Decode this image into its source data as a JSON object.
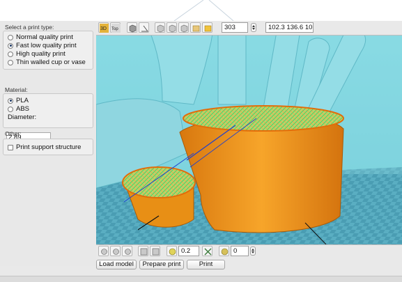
{
  "print_type": {
    "title": "Select a print type:",
    "options": [
      {
        "label": "Normal quality print",
        "selected": false
      },
      {
        "label": "Fast low quality print",
        "selected": true
      },
      {
        "label": "High quality print",
        "selected": false
      },
      {
        "label": "Thin walled cup or vase",
        "selected": false
      }
    ]
  },
  "material": {
    "title": "Material:",
    "options": [
      {
        "label": "PLA",
        "selected": true
      },
      {
        "label": "ABS",
        "selected": false
      }
    ],
    "diameter_label": "Diameter:",
    "diameter_value": "2.89"
  },
  "other": {
    "title": "Other:",
    "support_label": "Print support structure",
    "support_checked": false
  },
  "toolbar": {
    "icons": [
      "3d-view-icon",
      "top-view-icon",
      "cube-icon",
      "angle-icon",
      "layer-view-icon",
      "layer-view-icon",
      "layer-view-icon",
      "toolpath-view-icon",
      "model-view-icon"
    ],
    "btn_3d": "3D",
    "btn_top": "Top",
    "layer_value": "303",
    "dimensions_value": "102.3 136.6 10"
  },
  "bottom_toolbar": {
    "scale_value": "0.2",
    "rotate_value": "0"
  },
  "actions": {
    "load": "Load model",
    "prepare": "Prepare print",
    "print": "Print"
  },
  "colors": {
    "background_cyan": "#7bd5df",
    "build_plate": "#4e9eb4",
    "model_orange": "#f29c1c",
    "model_translucent": "#92dbe5",
    "infill_green": "#8ee03c"
  }
}
